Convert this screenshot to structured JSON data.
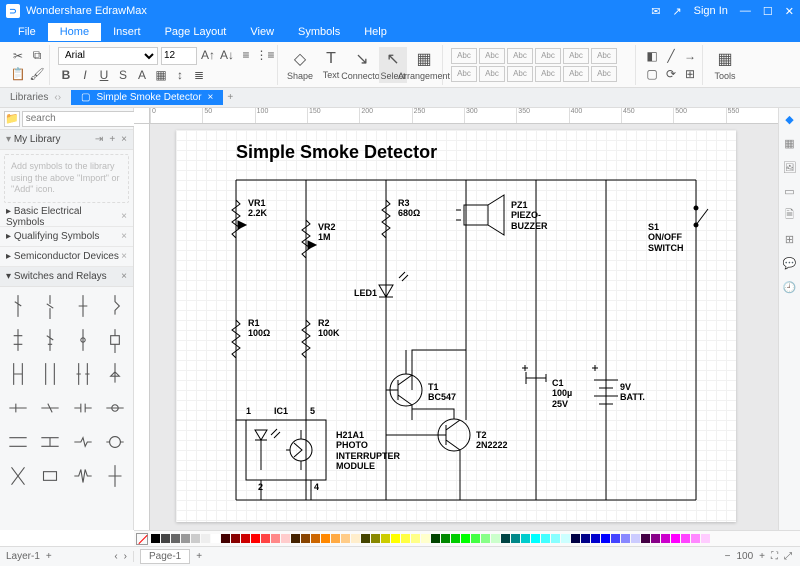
{
  "app": {
    "title": "Wondershare EdrawMax",
    "signin": "Sign In"
  },
  "menu": {
    "file": "File",
    "home": "Home",
    "insert": "Insert",
    "pagelayout": "Page Layout",
    "view": "View",
    "symbols": "Symbols",
    "help": "Help"
  },
  "ribbon": {
    "font": "Arial",
    "size": "12",
    "shape": "Shape",
    "text": "Text",
    "connector": "Connector",
    "select": "Select",
    "arrangement": "Arrangement",
    "tools": "Tools",
    "quick": "Abc"
  },
  "tabs": {
    "libraries": "Libraries",
    "doc": "Simple Smoke Detector"
  },
  "sidebar": {
    "search_placeholder": "search",
    "mylib": "My Library",
    "hint": "Add symbols to the library using the above \"Import\" or \"Add\" icon.",
    "cats": [
      "Basic Electrical Symbols",
      "Qualifying Symbols",
      "Semiconductor Devices",
      "Switches and Relays"
    ]
  },
  "diagram": {
    "title": "Simple Smoke Detector",
    "labels": {
      "vr1": "VR1\n2.2K",
      "vr2": "VR2\n1M",
      "r3": "R3\n680Ω",
      "pz1": "PZ1\nPIEZO-\nBUZZER",
      "s1": "S1\nON/OFF\nSWITCH",
      "r1": "R1\n100Ω",
      "r2": "R2\n100K",
      "led1": "LED1",
      "ic1": "IC1",
      "ic1_1": "1",
      "ic1_2": "2",
      "ic1_4": "4",
      "ic1_5": "5",
      "t1": "T1\nBC547",
      "t2": "T2\n2N2222",
      "h21": "H21A1\nPHOTO\nINTERRUPTER\nMODULE",
      "c1": "C1\n100µ\n25V",
      "batt": "9V\nBATT."
    }
  },
  "status": {
    "layer": "Layer-1",
    "page": "Page-1",
    "zoom": "100"
  }
}
